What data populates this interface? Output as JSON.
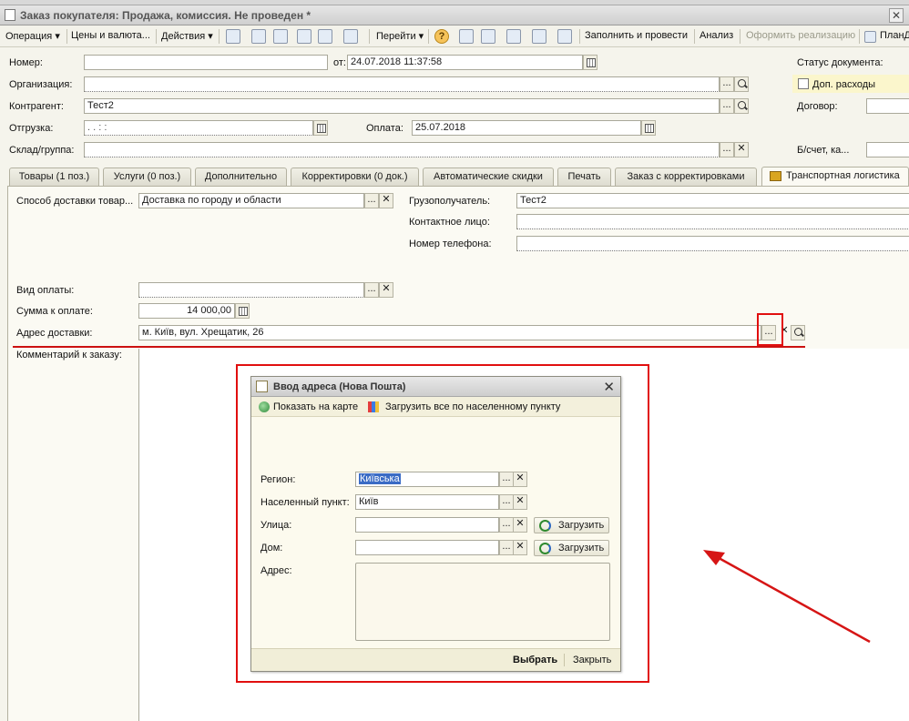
{
  "window": {
    "title": "Заказ покупателя: Продажа, комиссия. Не проведен *"
  },
  "toolbar": {
    "operation": "Операция",
    "prices": "Цены и валюта...",
    "actions": "Действия",
    "goto": "Перейти",
    "fill_and_post": "Заполнить и провести",
    "analysis": "Анализ",
    "make_sale": "Оформить реализацию",
    "plan": "ПланД"
  },
  "header": {
    "number_label": "Номер:",
    "number_value": "",
    "from_label": "от:",
    "date_value": "24.07.2018 11:37:58",
    "status_label": "Статус документа:",
    "org_label": "Организация:",
    "org_value": "",
    "extra_costs_label": "Доп. расходы",
    "contractor_label": "Контрагент:",
    "contractor_value": "Тест2",
    "contract_label": "Договор:",
    "shipment_label": "Отгрузка:",
    "shipment_value": " .  .     :  :",
    "payment_label": "Оплата:",
    "payment_value": "25.07.2018",
    "warehouse_label": "Склад/группа:",
    "warehouse_value": "",
    "account_label": "Б/счет, ка..."
  },
  "tabs": [
    {
      "label": "Товары (1 поз.)"
    },
    {
      "label": "Услуги (0 поз.)"
    },
    {
      "label": "Дополнительно"
    },
    {
      "label": "Корректировки (0 док.)"
    },
    {
      "label": "Автоматические скидки"
    },
    {
      "label": "Печать"
    },
    {
      "label": "Заказ с корректировками"
    },
    {
      "label": "Транспортная логистика"
    }
  ],
  "logistics": {
    "delivery_method_label": "Способ доставки товар...",
    "delivery_method_value": "Доставка по городу и области",
    "consignee_label": "Грузополучатель:",
    "consignee_value": "Тест2",
    "contact_label": "Контактное лицо:",
    "contact_value": "",
    "phone_label": "Номер телефона:",
    "phone_value": "",
    "payment_type_label": "Вид оплаты:",
    "payment_type_value": "",
    "amount_label": "Сумма к оплате:",
    "amount_value": "14 000,00",
    "address_label": "Адрес доставки:",
    "address_value": "м. Київ, вул. Хрещатик, 26",
    "comment_label": "Комментарий к заказу:"
  },
  "dialog": {
    "title": "Ввод адреса (Нова Пошта)",
    "show_on_map": "Показать на карте",
    "load_all": "Загрузить все по населенному пункту",
    "region_label": "Регион:",
    "region_value": "Київська",
    "city_label": "Населенный пункт:",
    "city_value": "Київ",
    "street_label": "Улица:",
    "street_value": "",
    "house_label": "Дом:",
    "house_value": "",
    "address_label": "Адрес:",
    "address_value": "",
    "load_button": "Загрузить",
    "select_button": "Выбрать",
    "close_button": "Закрыть"
  },
  "colors": {
    "annotation_red": "#e10f0f",
    "selection_blue": "#3a6bc5"
  }
}
